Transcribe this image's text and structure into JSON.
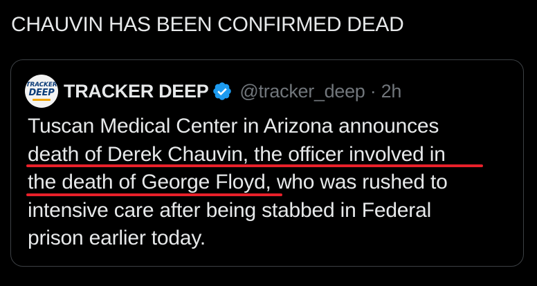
{
  "post": {
    "text": "CHAUVIN HAS BEEN CONFIRMED DEAD"
  },
  "quote": {
    "display_name": "TRACKER DEEP",
    "verified": true,
    "handle_time": "@tracker_deep · 2h",
    "avatar_logo_text": [
      "TRACKER",
      "DEEP"
    ],
    "body_lines": [
      "Tuscan Medical Center in Arizona announces",
      "death of Derek Chauvin, the officer involved in",
      "the death of George Floyd, who was rushed to",
      "intensive care after being stabbed in Federal",
      "prison earlier today."
    ]
  },
  "colors": {
    "background": "#000000",
    "text_primary": "#e7e9ea",
    "text_secondary": "#71767b",
    "card_border": "#3d4145",
    "verified_badge": "#1d9bf0",
    "highlight_underline": "#e8202a"
  },
  "icons": [
    "verified-badge-icon"
  ]
}
